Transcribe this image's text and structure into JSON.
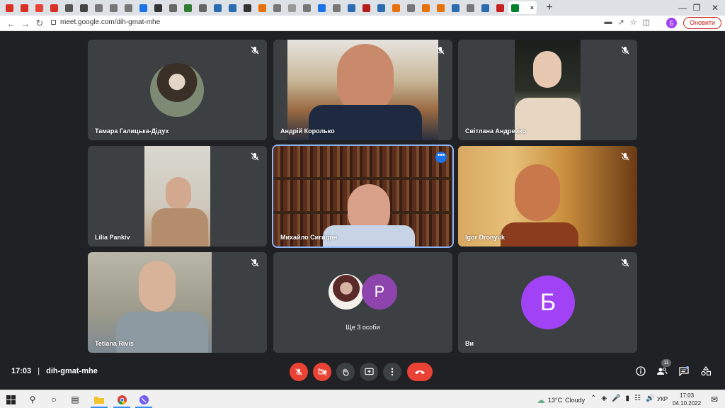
{
  "browser": {
    "tab_count_icons": 34,
    "url": "meet.google.com/dih-gmat-mhe",
    "profile_initial": "Б",
    "update_label": "Оновити"
  },
  "tiles": [
    {
      "name": "Тамара Галицька-Дідух",
      "mic_muted": true
    },
    {
      "name": "Андрій Королько",
      "mic_muted": true
    },
    {
      "name": "Світлана Андрейко",
      "mic_muted": true
    },
    {
      "name": "Lilia Pankiv",
      "mic_muted": true
    },
    {
      "name": "Михайло Сигидин",
      "mic_muted": false
    },
    {
      "name": "Igor Dronyuk",
      "mic_muted": true
    },
    {
      "name": "Tetiana Rivis",
      "mic_muted": true
    },
    {
      "name": "Ще 3 особи",
      "avatar_letter": "P"
    },
    {
      "name": "Ви",
      "avatar_letter": "Б",
      "mic_muted": true
    }
  ],
  "meeting": {
    "time": "17:03",
    "code": "dih-gmat-mhe",
    "participants_count": "11"
  },
  "colors": {
    "meet_bg": "#202124",
    "tile_bg": "#3c4043",
    "red": "#ea4335",
    "you_avatar": "#a142f4",
    "others_avatar": "#8e44ad",
    "active_border": "#8ab4f8"
  },
  "taskbar": {
    "weather_temp": "13°C",
    "weather_desc": "Cloudy",
    "lang": "УКР",
    "clock_time": "17:03",
    "clock_date": "04.10.2022"
  }
}
